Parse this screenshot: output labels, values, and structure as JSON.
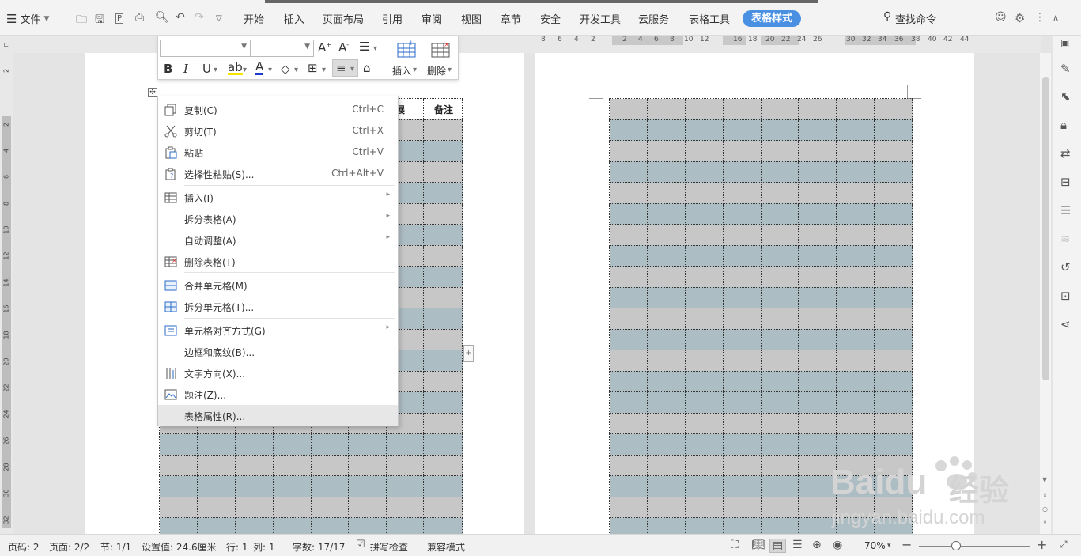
{
  "topbar": {
    "file_menu": "文件",
    "tabs": [
      "开始",
      "插入",
      "页面布局",
      "引用",
      "审阅",
      "视图",
      "章节",
      "安全",
      "开发工具",
      "云服务",
      "表格工具"
    ],
    "active_tab": "表格样式",
    "search": "查找命令"
  },
  "ruler": {
    "numbers": [
      "8",
      "6",
      "4",
      "2",
      "2",
      "4",
      "6",
      "8",
      "10",
      "12",
      "16",
      "18",
      "20",
      "22",
      "24",
      "26",
      "30",
      "32",
      "34",
      "36",
      "38",
      "40",
      "42",
      "44"
    ],
    "vnumbers": [
      "2",
      "2",
      "4",
      "6",
      "8",
      "10",
      "12",
      "14",
      "16",
      "18",
      "20",
      "22",
      "24",
      "26",
      "28",
      "30",
      "32"
    ]
  },
  "table": {
    "headers": [
      "进展",
      "备注"
    ]
  },
  "mini_toolbar": {
    "insert_label": "插入",
    "delete_label": "删除"
  },
  "context_menu": {
    "items": [
      {
        "label": "复制(C)",
        "shortcut": "Ctrl+C",
        "icon": "copy-icon"
      },
      {
        "label": "剪切(T)",
        "shortcut": "Ctrl+X",
        "icon": "cut-icon"
      },
      {
        "label": "粘贴",
        "shortcut": "Ctrl+V",
        "icon": "paste-icon"
      },
      {
        "label": "选择性粘贴(S)...",
        "shortcut": "Ctrl+Alt+V",
        "icon": "paste-special-icon"
      },
      {
        "label": "插入(I)",
        "shortcut": "",
        "icon": "insert-table-icon"
      },
      {
        "label": "拆分表格(A)",
        "shortcut": "",
        "icon": ""
      },
      {
        "label": "自动调整(A)",
        "shortcut": "",
        "icon": ""
      },
      {
        "label": "删除表格(T)",
        "shortcut": "",
        "icon": "delete-table-icon"
      },
      {
        "label": "合并单元格(M)",
        "shortcut": "",
        "icon": "merge-cells-icon"
      },
      {
        "label": "拆分单元格(T)...",
        "shortcut": "",
        "icon": "split-cells-icon"
      },
      {
        "label": "单元格对齐方式(G)",
        "shortcut": "",
        "icon": "cell-align-icon"
      },
      {
        "label": "边框和底纹(B)...",
        "shortcut": "",
        "icon": ""
      },
      {
        "label": "文字方向(X)...",
        "shortcut": "",
        "icon": "text-direction-icon"
      },
      {
        "label": "题注(Z)...",
        "shortcut": "",
        "icon": "caption-icon"
      },
      {
        "label": "表格属性(R)...",
        "shortcut": "",
        "icon": ""
      }
    ]
  },
  "status": {
    "page_code": "页码: 2",
    "pages": "页面: 2/2",
    "section": "节: 1/1",
    "setting": "设置值: 24.6厘米",
    "row": "行: 1",
    "col": "列: 1",
    "words": "字数: 17/17",
    "spell": "拼写检查",
    "compat": "兼容模式",
    "zoom": "70%"
  },
  "watermark": {
    "brand": "Baidu",
    "brand_cn": "经验",
    "url": "jingyan.baidu.com"
  }
}
